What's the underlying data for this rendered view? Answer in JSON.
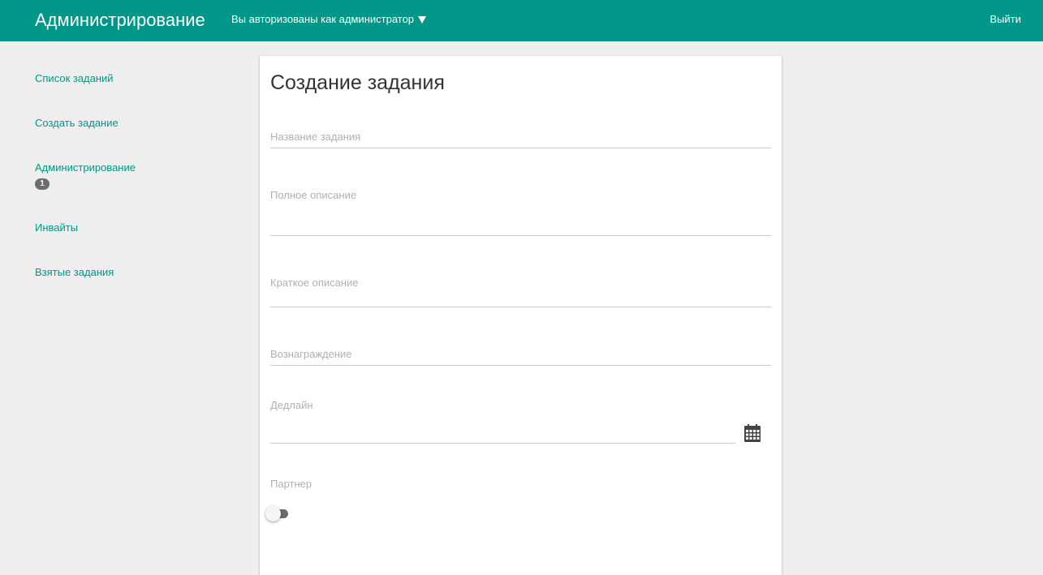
{
  "header": {
    "title": "Администрирование",
    "user_label": "Вы авторизованы как администратор",
    "logout_label": "Выйти",
    "background_color": "#009688"
  },
  "sidebar": {
    "items": [
      {
        "label": "Список заданий"
      },
      {
        "label": "Создать задание"
      },
      {
        "label": "Администрирование",
        "badge": "1"
      },
      {
        "label": "Инвайты"
      },
      {
        "label": "Взятые задания"
      }
    ]
  },
  "form": {
    "title": "Создание задания",
    "fields": {
      "name": {
        "label": "Название задания",
        "value": ""
      },
      "full_description": {
        "label": "Полное описание",
        "value": ""
      },
      "short_description": {
        "label": "Краткое описание",
        "value": ""
      },
      "reward": {
        "label": "Вознаграждение",
        "value": ""
      },
      "deadline": {
        "label": "Дедлайн",
        "value": "",
        "icon": "calendar-icon"
      },
      "partner": {
        "label": "Партнер",
        "checked": false
      }
    }
  }
}
